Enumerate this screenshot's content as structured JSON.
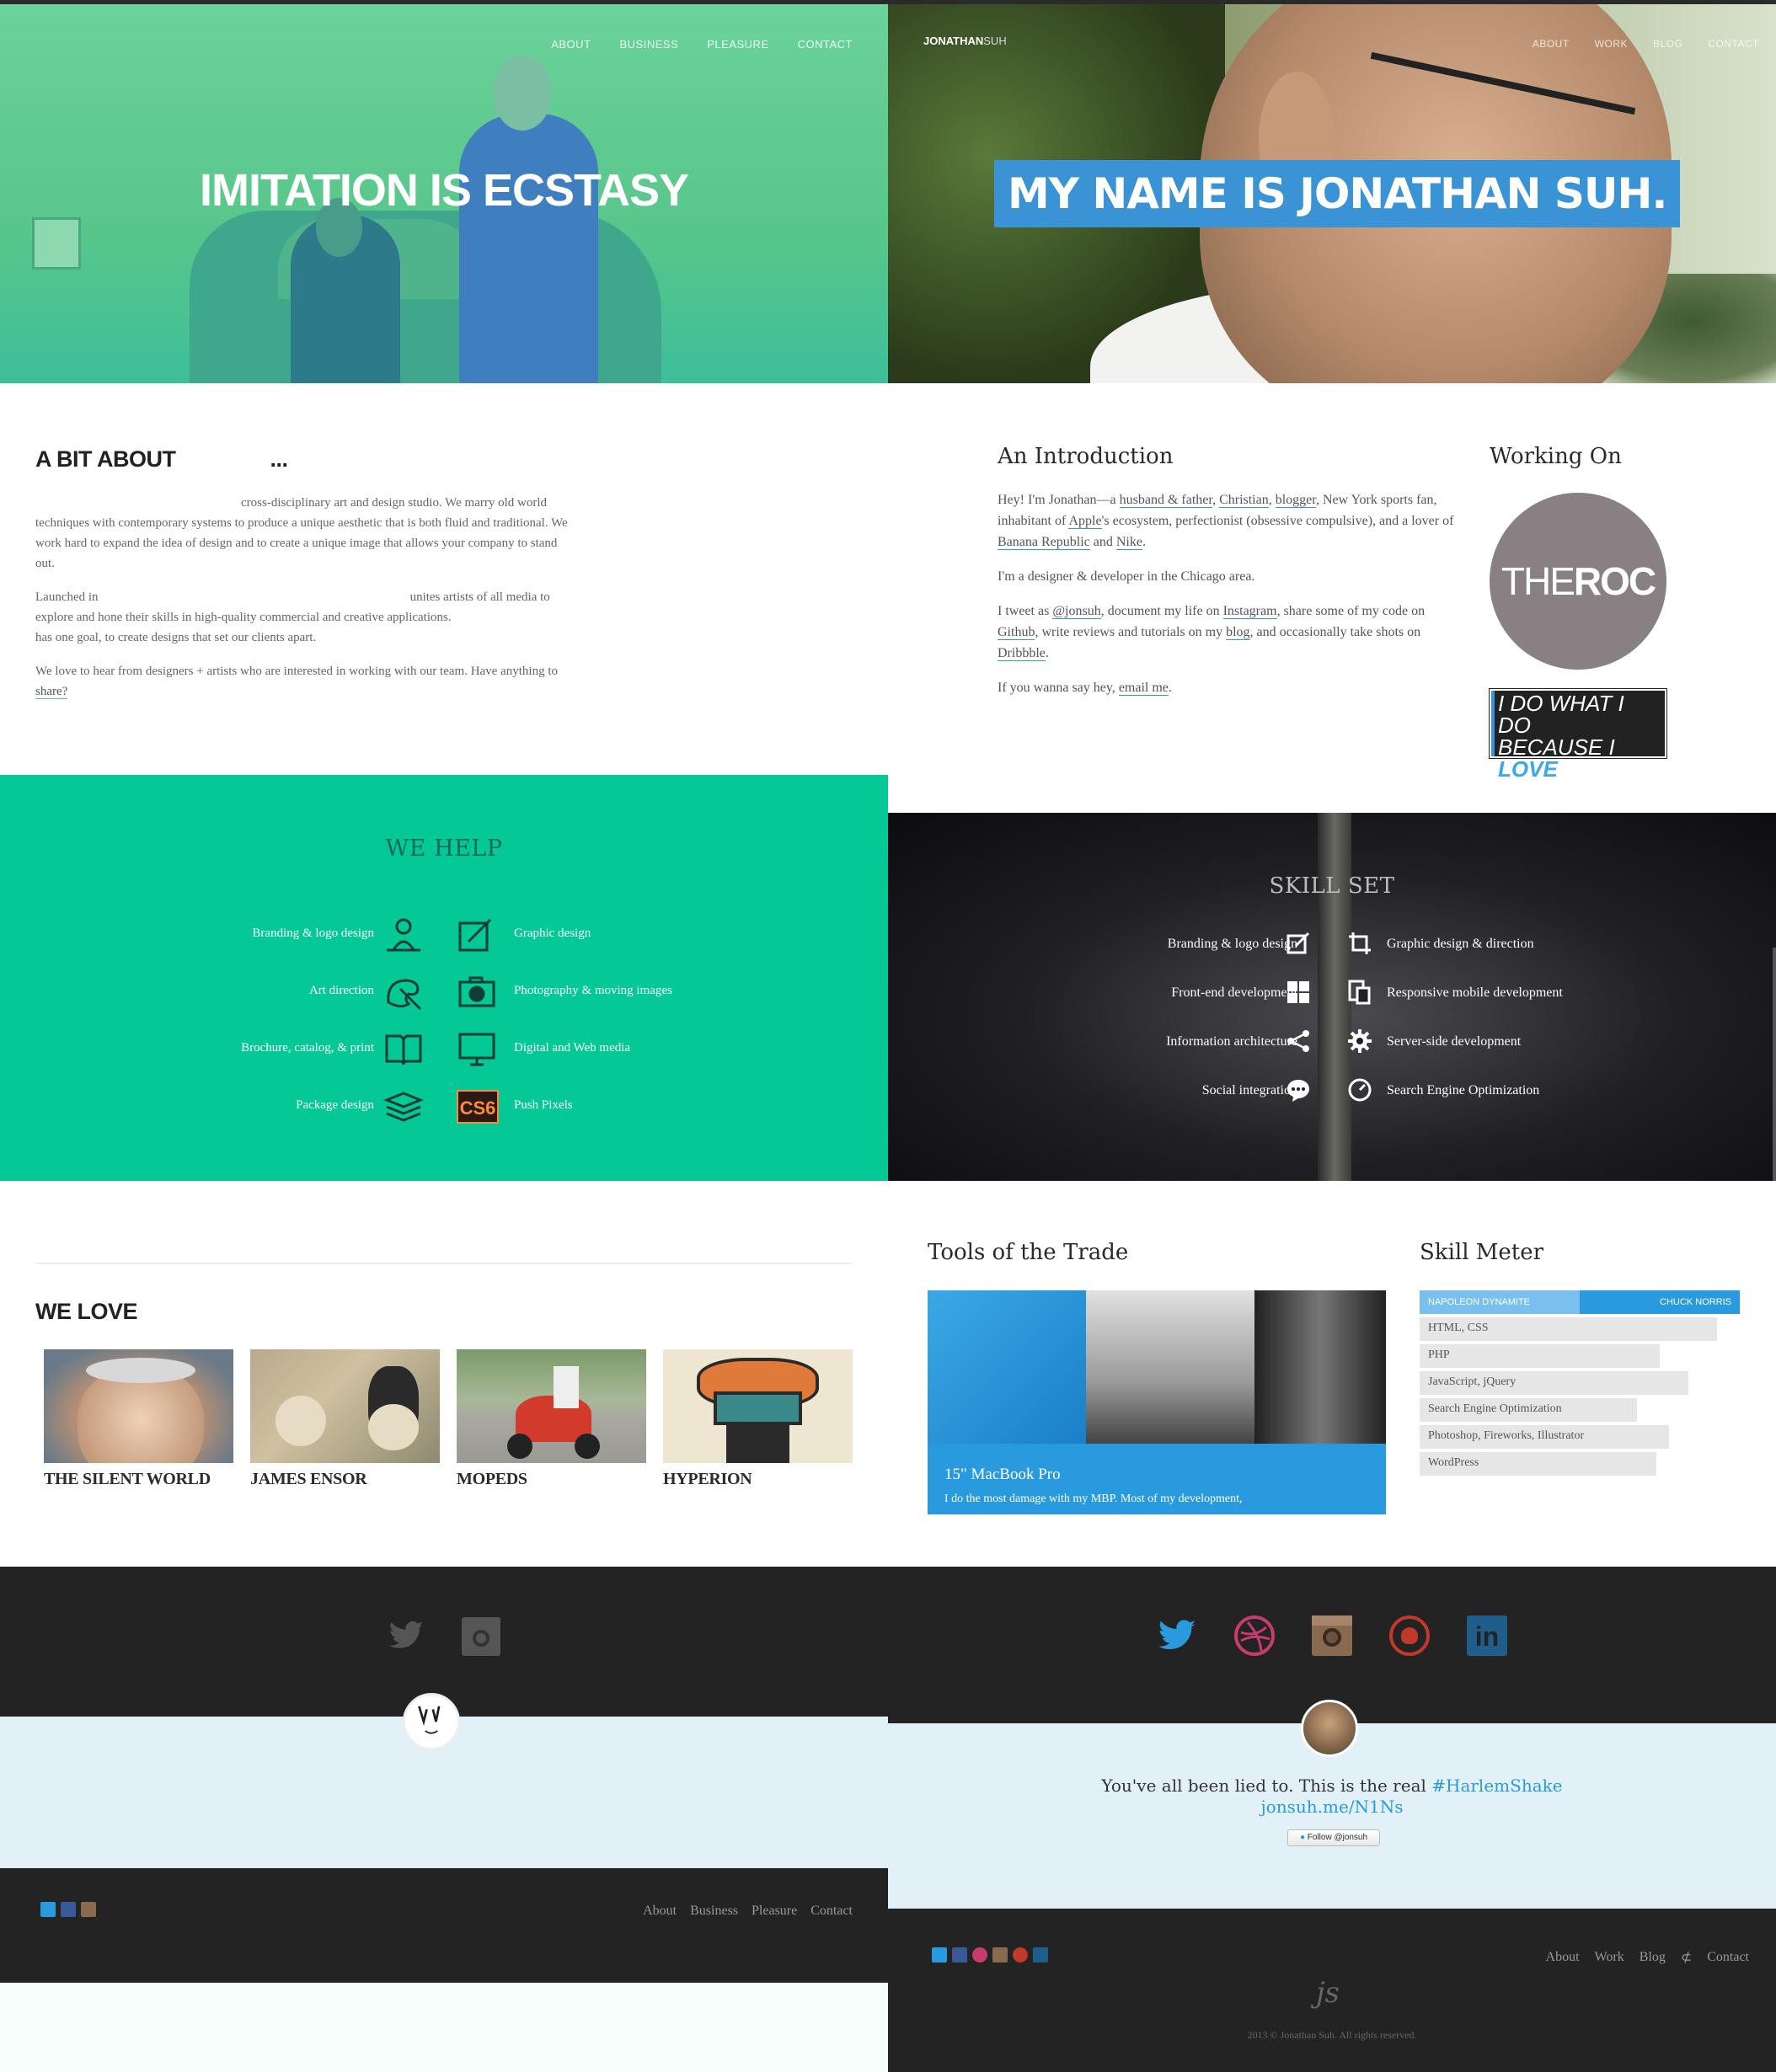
{
  "left": {
    "nav": [
      "ABOUT",
      "BUSINESS",
      "PLEASURE",
      "CONTACT"
    ],
    "hero_title": "IMITATION IS ECSTASY",
    "about": {
      "heading": "A BIT ABOUT",
      "heading_tail": "...",
      "p1": "cross-disciplinary art and design studio. We marry old world techniques with contemporary systems to produce a unique aesthetic that is both fluid and traditional. We work hard to expand the idea of design and to create a unique image that allows your company to stand out.",
      "p2_a": "Launched in",
      "p2_b": "unites artists of all media to explore and hone their skills in high-quality commercial and creative applications.",
      "p2_c": "has one goal, to create designs that set our clients apart.",
      "p3": "We love to hear from designers + artists who are interested in working with our team. Have anything to",
      "p3_link": "share?"
    },
    "we_help": {
      "title": "WE HELP",
      "left_items": [
        "Branding & logo design",
        "Art direction",
        "Brochure, catalog, & print",
        "Package design"
      ],
      "right_items": [
        "Graphic design",
        "Photography & moving images",
        "Digital and Web media",
        "Push Pixels"
      ],
      "cs6_label": "CS6"
    },
    "we_love": {
      "title": "WE LOVE",
      "items": [
        "THE SILENT WORLD",
        "JAMES ENSOR",
        "MOPEDS",
        "HYPERION"
      ]
    },
    "footer_links": [
      "About",
      "Business",
      "Pleasure",
      "Contact"
    ],
    "colors": {
      "hero_tint": "#5ecb8c",
      "help_bg": "#04c896"
    }
  },
  "right": {
    "logo_bold": "JONATHAN",
    "logo_light": "SUH",
    "nav": [
      "ABOUT",
      "WORK",
      "BLOG",
      "CONTACT"
    ],
    "hero_title": "MY NAME IS JONATHAN SUH.",
    "intro": {
      "heading": "An Introduction",
      "p1_pre": "Hey! I'm Jonathan—a",
      "p1_links": [
        "husband & father",
        "Christian",
        "blogger"
      ],
      "p1_mid": "New York sports fan, inhabitant of",
      "p1_apple": "Apple",
      "p1_post": "'s ecosystem, perfectionist (obsessive compulsive), and a lover of",
      "p1_br": "Banana Republic",
      "p1_and": "and",
      "p1_nike": "Nike",
      "p2": "I'm a designer & developer in the Chicago area.",
      "p3_pre": "I tweet as",
      "p3_jonsuh": "@jonsuh",
      "p3_a": ", document my life on",
      "p3_insta": "Instagram",
      "p3_b": ", share some of my code on",
      "p3_github": "Github",
      "p3_c": ", write reviews and tutorials on my",
      "p3_blog": "blog",
      "p3_d": ", and occasionally take shots on",
      "p3_dribbble": "Dribbble",
      "p4_pre": "If you wanna say hey,",
      "p4_link": "email me"
    },
    "working_on": {
      "heading": "Working On",
      "roc_light": "THE",
      "roc_bold": "ROC",
      "tag_l1": "I DO WHAT I DO",
      "tag_l2a": "BECAUSE I",
      "tag_l2b": "LOVE",
      "tag_l3": "WHAT I DO"
    },
    "skill_set": {
      "title": "SKILL SET",
      "left_items": [
        "Branding & logo design",
        "Front-end development",
        "Information architecture",
        "Social integration"
      ],
      "right_items": [
        "Graphic design & direction",
        "Responsive mobile development",
        "Server-side development",
        "Search Engine Optimization"
      ]
    },
    "tools": {
      "heading": "Tools of the Trade",
      "item_title": "15\" MacBook Pro",
      "item_desc": "I do the most damage with my MBP. Most of my development,"
    },
    "skill_meter": {
      "heading": "Skill Meter",
      "scale_left": "NAPOLEON DYNAMITE",
      "scale_right": "CHUCK NORRIS",
      "skills": [
        {
          "name": "HTML, CSS",
          "level": 0.93
        },
        {
          "name": "PHP",
          "level": 0.75
        },
        {
          "name": "JavaScript, jQuery",
          "level": 0.84
        },
        {
          "name": "Search Engine Optimization",
          "level": 0.68
        },
        {
          "name": "Photoshop, Fireworks, Illustrator",
          "level": 0.78
        },
        {
          "name": "WordPress",
          "level": 0.74
        }
      ]
    },
    "tweet": {
      "text": "You've all been lied to. This is the real",
      "hashtag": "#HarlemShake",
      "link": "jonsuh.me/N1Ns",
      "follow_label": "Follow @jonsuh"
    },
    "footer_links": [
      "About",
      "Work",
      "Blog",
      "Contact"
    ],
    "monogram": "js",
    "copyright": "2013 © Jonathan Suh. All rights reserved.",
    "colors": {
      "accent": "#3a93d4",
      "twitter": "#2a9adf",
      "dribbble": "#c73b6f",
      "instagram": "#8a6a4e",
      "github": "#c0392b",
      "linkedin": "#1f5e8a"
    }
  }
}
